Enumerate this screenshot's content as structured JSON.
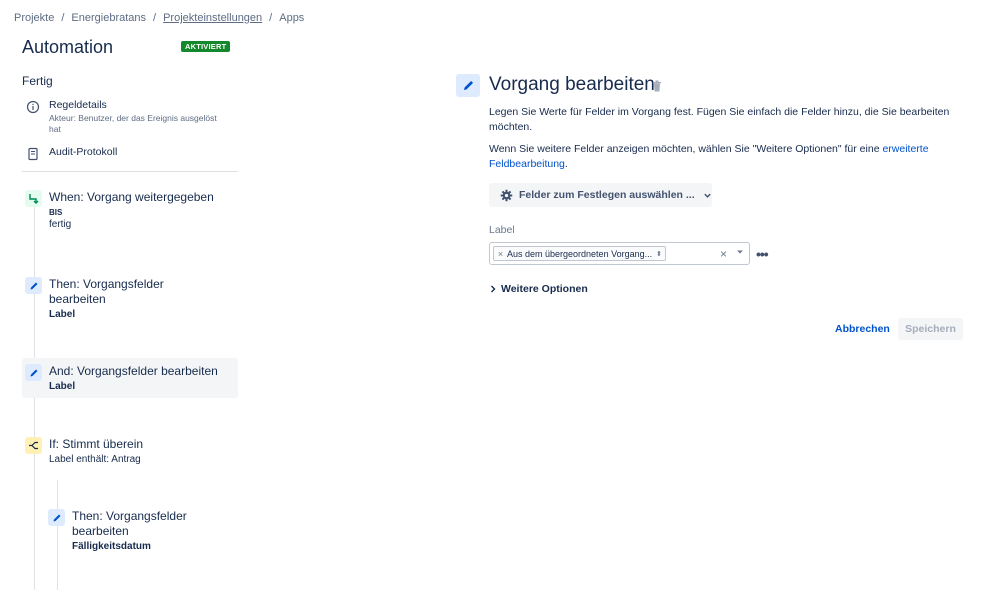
{
  "breadcrumb": {
    "items": [
      "Projekte",
      "Energiebratans",
      "Projekteinstellungen",
      "Apps"
    ],
    "separator": "/"
  },
  "header": {
    "title": "Automation",
    "status": "AKTIVIERT"
  },
  "sidebar": {
    "section_label": "Fertig",
    "rule_details": {
      "title": "Regeldetails",
      "subtitle": "Akteur: Benutzer, der das Ereignis ausgelöst hat"
    },
    "audit_log": "Audit-Protokoll",
    "steps": [
      {
        "title": "When: Vorgang weitergegeben",
        "sub_small": "BIS",
        "sub": "fertig",
        "icon": "trigger-branch-icon"
      },
      {
        "title": "Then: Vorgangsfelder bearbeiten",
        "sub_b": "Label",
        "icon": "pencil-icon"
      },
      {
        "title": "And: Vorgangsfelder bearbeiten",
        "sub_b": "Label",
        "icon": "pencil-icon"
      },
      {
        "title": "If: Stimmt überein",
        "sub": "Label enthält: Antrag",
        "icon": "condition-branch-icon"
      },
      {
        "title": "Then: Vorgangsfelder bearbeiten",
        "sub_b": "Fälligkeitsdatum",
        "icon": "pencil-icon"
      }
    ]
  },
  "panel": {
    "title": "Vorgang bearbeiten",
    "desc1": "Legen Sie Werte für Felder im Vorgang fest. Fügen Sie einfach die Felder hinzu, die Sie bearbeiten möchten.",
    "desc2_prefix": "Wenn Sie weitere Felder anzeigen möchten, wählen Sie \"Weitere Optionen\" für eine ",
    "desc2_link": "erweiterte Feldbearbeitung",
    "desc2_suffix": ".",
    "fields_button": "Felder zum Festlegen auswählen ...",
    "label_field": {
      "label": "Label",
      "chip_value": "Aus dem übergeordneten Vorgang..."
    },
    "more_options": "Weitere Optionen",
    "cancel": "Abbrechen",
    "save": "Speichern"
  },
  "colors": {
    "accent": "#0052cc",
    "status_green": "#14892c",
    "text": "#172b4d"
  }
}
